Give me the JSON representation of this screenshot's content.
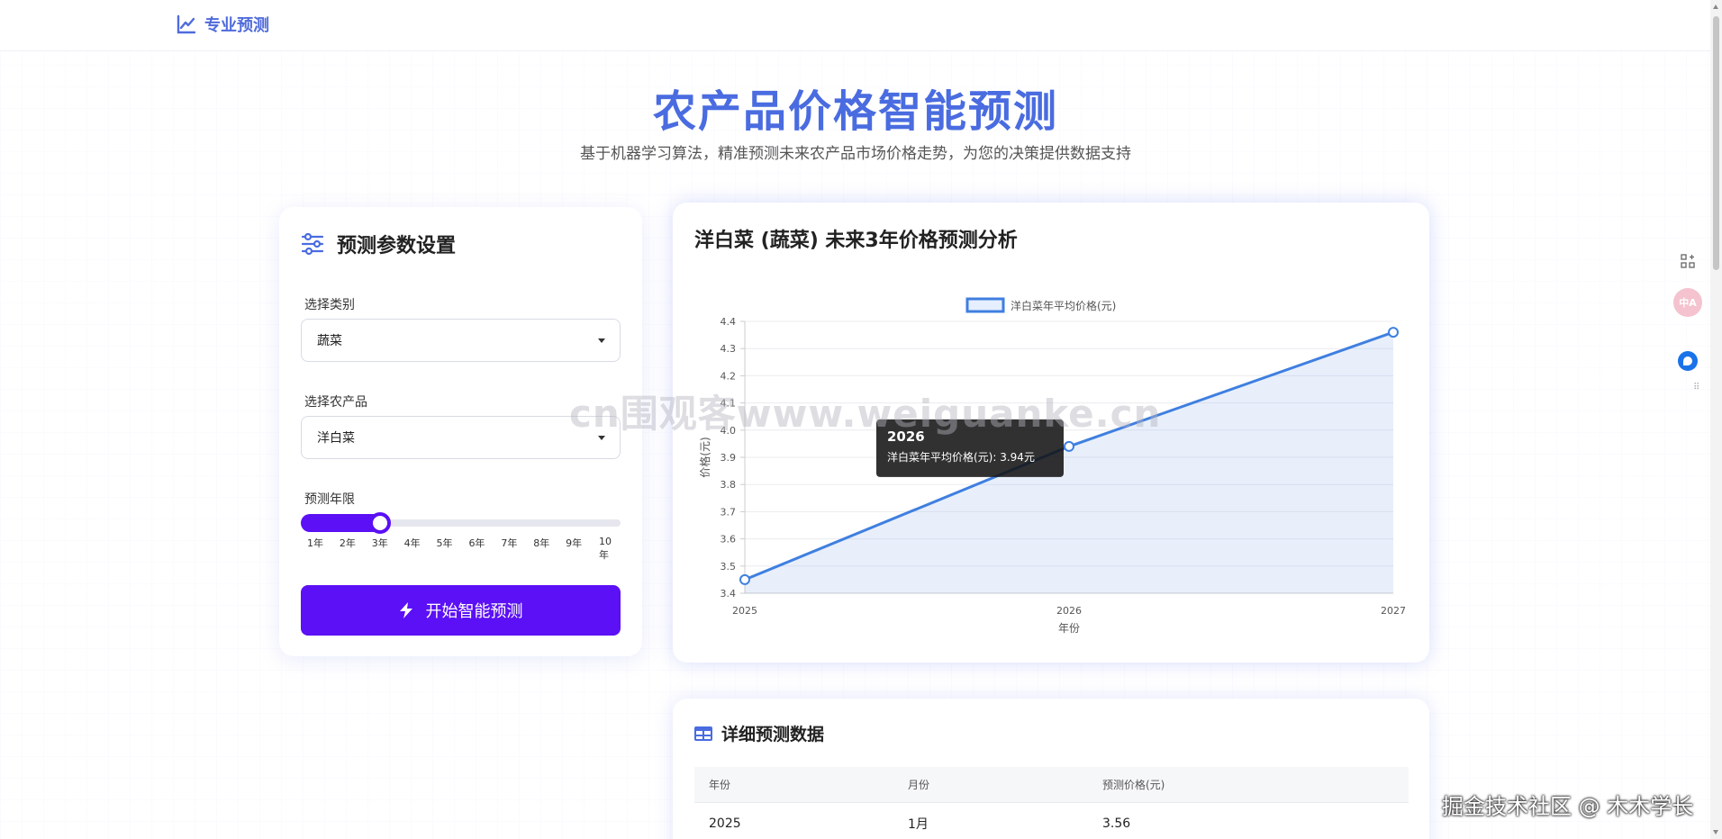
{
  "nav": {
    "brand": "专业预测"
  },
  "hero": {
    "title": "农产品价格智能预测",
    "subtitle": "基于机器学习算法，精准预测未来农产品市场价格走势，为您的决策提供数据支持"
  },
  "settings": {
    "title": "预测参数设置",
    "category_label": "选择类别",
    "category_value": "蔬菜",
    "product_label": "选择农产品",
    "product_value": "洋白菜",
    "years_label": "预测年限",
    "years_value": 3,
    "years_min": 1,
    "years_max": 10,
    "year_ticks": [
      "1年",
      "2年",
      "3年",
      "4年",
      "5年",
      "6年",
      "7年",
      "8年",
      "9年",
      "10年"
    ],
    "button_label": "开始智能预测"
  },
  "chart_panel": {
    "title": "洋白菜 (蔬菜) 未来3年价格预测分析"
  },
  "chart_data": {
    "type": "line",
    "x": [
      "2025",
      "2026",
      "2027"
    ],
    "series": [
      {
        "name": "洋白菜年平均价格(元)",
        "values": [
          3.45,
          3.94,
          4.36
        ],
        "color": "#3f7fe0"
      }
    ],
    "xlabel": "年份",
    "ylabel": "价格(元)",
    "ylim": [
      3.4,
      4.4
    ],
    "yticks": [
      "3.4",
      "3.5",
      "3.6",
      "3.7",
      "3.8",
      "3.9",
      "4.0",
      "4.1",
      "4.2",
      "4.3",
      "4.4"
    ],
    "legend": "top",
    "grid": true,
    "tooltip": {
      "title": "2026",
      "text": "洋白菜年平均价格(元): 3.94元"
    }
  },
  "table_panel": {
    "title": "详细预测数据",
    "columns": [
      "年份",
      "月份",
      "预测价格(元)"
    ],
    "rows": [
      [
        "2025",
        "1月",
        "3.56"
      ]
    ]
  },
  "overlay": {
    "watermark": "cn围观客www.weiguanke.cn",
    "credit": "掘金技术社区 @ 木木学长",
    "translate_badge": "中A"
  },
  "colors": {
    "accent": "#5b10f5",
    "brand": "#4a6ce0",
    "line": "#3f7fe0"
  },
  "icons": [
    "chart-line-icon",
    "sliders-icon",
    "bolt-icon",
    "table-icon",
    "apps-icon",
    "translate-icon",
    "chat-icon"
  ]
}
